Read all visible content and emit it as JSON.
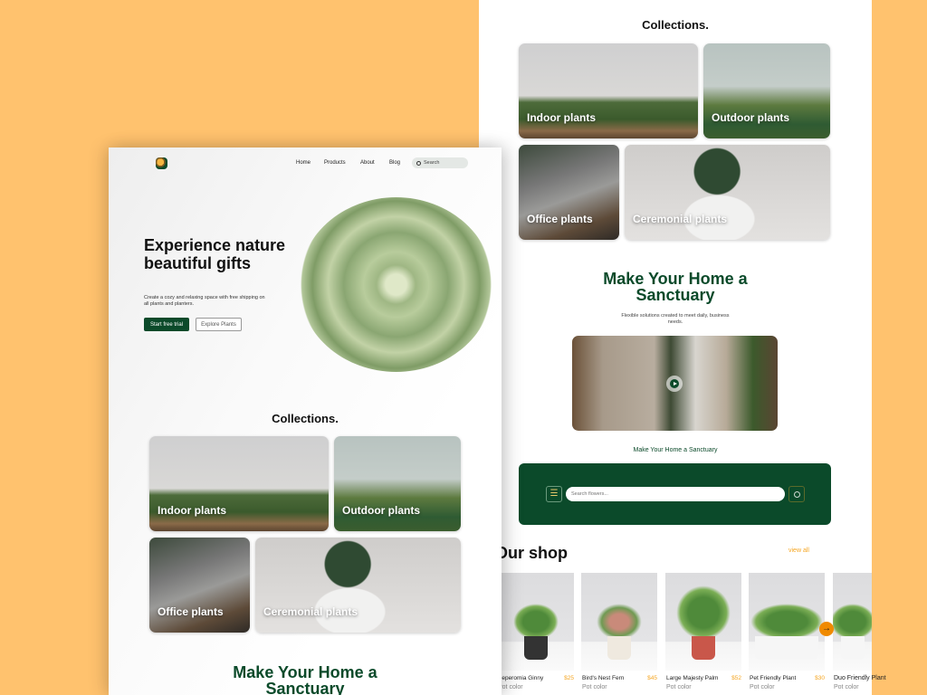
{
  "left": {
    "nav": {
      "items": [
        "Home",
        "Products",
        "About",
        "Blog"
      ],
      "search_placeholder": "Search"
    },
    "hero": {
      "title": "Experience nature beautiful gifts",
      "subtitle": "Create a cozy and relaxing space with free shipping on all plants and planters.",
      "primary_button": "Start free trial",
      "secondary_button": "Explore Plants"
    },
    "collections": {
      "title": "Collections.",
      "items": [
        "Indoor plants",
        "Outdoor plants",
        "Office plants",
        "Ceremonial plants"
      ]
    },
    "sanctuary_title": "Make Your Home a Sanctuary"
  },
  "right": {
    "collections": {
      "title": "Collections.",
      "items": [
        "Indoor plants",
        "Outdoor plants",
        "Office plants",
        "Ceremonial plants"
      ]
    },
    "sanctuary": {
      "title": "Make Your Home a Sanctuary",
      "subtitle": "Flexible solutions  created to meet daily, business needs.",
      "caption": "Make Your Home a Sanctuary"
    },
    "search": {
      "placeholder": "Search flowers..."
    },
    "shop": {
      "title": "Our shop",
      "view_all": "view all",
      "products": [
        {
          "name": "Peperomia Ginny",
          "price": "$25",
          "pot_label": "Pot color"
        },
        {
          "name": "Bird's Nest Fern",
          "price": "$45",
          "pot_label": "Pot color"
        },
        {
          "name": "Large Majesty Palm",
          "price": "$52",
          "pot_label": "Pot color"
        },
        {
          "name": "Pet Friendly Plant",
          "price": "$30",
          "pot_label": "Pot color"
        },
        {
          "name": "Duo Friendly Plant",
          "price": "",
          "pot_label": "Pot color"
        }
      ]
    }
  },
  "colors": {
    "background": "#FFC26E",
    "brand_green": "#0B4A2A",
    "accent_orange": "#F5A623"
  }
}
